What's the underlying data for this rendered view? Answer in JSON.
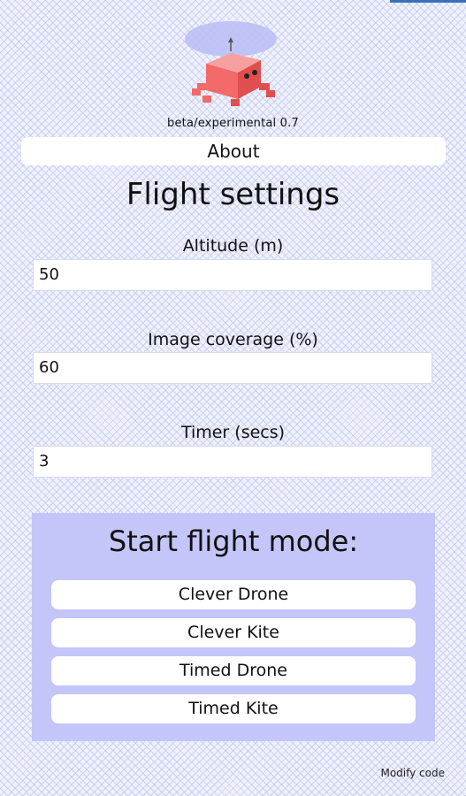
{
  "app": {
    "version": "beta/experimental 0.7"
  },
  "about": {
    "label": "About"
  },
  "flight_settings": {
    "title": "Flight settings",
    "fields": [
      {
        "label": "Altitude (m)",
        "value": "50"
      },
      {
        "label": "Image coverage (%)",
        "value": "60"
      },
      {
        "label": "Timer (secs)",
        "value": "3"
      }
    ]
  },
  "flight_mode": {
    "title": "Start flight mode:",
    "buttons": [
      {
        "label": "Clever Drone"
      },
      {
        "label": "Clever Kite"
      },
      {
        "label": "Timed Drone"
      },
      {
        "label": "Timed Kite"
      }
    ]
  },
  "footer": {
    "modify_label": "Modify code"
  },
  "colors": {
    "panel": "#c4c6fa",
    "robot": "#f26a6a",
    "accent": "#3b6fb8"
  },
  "icons": {
    "logo": "drone-robot-logo"
  }
}
